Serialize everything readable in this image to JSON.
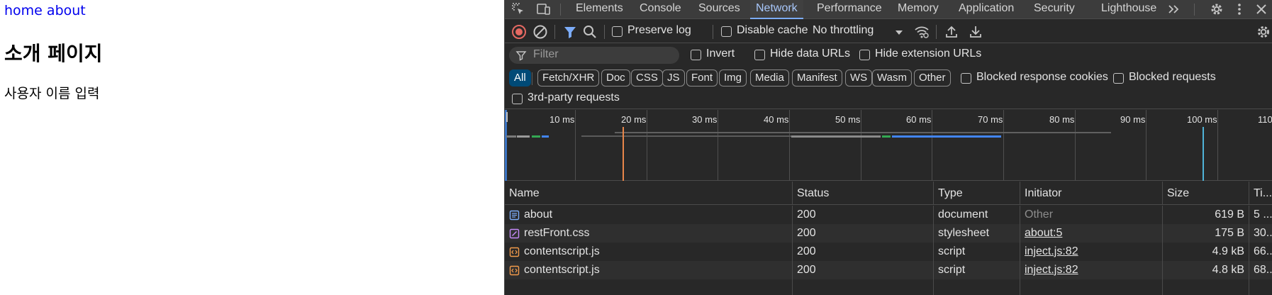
{
  "page": {
    "nav_links": [
      "home",
      "about"
    ],
    "heading": "소개 페이지",
    "body_text": "사용자 이름 입력"
  },
  "devtools": {
    "tabs": [
      "Elements",
      "Console",
      "Sources",
      "Network",
      "Performance",
      "Memory",
      "Application",
      "Security",
      "Lighthouse"
    ],
    "active_tab": "Network",
    "toolbar": {
      "preserve_log": "Preserve log",
      "disable_cache": "Disable cache",
      "throttling": "No throttling"
    },
    "filter": {
      "placeholder": "Filter",
      "invert": "Invert",
      "hide_data_urls": "Hide data URLs",
      "hide_extension_urls": "Hide extension URLs"
    },
    "type_filters": [
      "All",
      "Fetch/XHR",
      "Doc",
      "CSS",
      "JS",
      "Font",
      "Img",
      "Media",
      "Manifest",
      "WS",
      "Wasm",
      "Other"
    ],
    "blocked_response_cookies": "Blocked response cookies",
    "blocked_requests": "Blocked requests",
    "third_party_requests": "3rd-party requests",
    "timeline_ticks": [
      "10 ms",
      "20 ms",
      "30 ms",
      "40 ms",
      "50 ms",
      "60 ms",
      "70 ms",
      "80 ms",
      "90 ms",
      "100 ms",
      "110"
    ],
    "columns": [
      "Name",
      "Status",
      "Type",
      "Initiator",
      "Size",
      "Ti..."
    ],
    "rows": [
      {
        "name": "about",
        "status": "200",
        "type": "document",
        "initiator": "Other",
        "size": "619 B",
        "time": "5 ...",
        "icon": "document-icon"
      },
      {
        "name": "restFront.css",
        "status": "200",
        "type": "stylesheet",
        "initiator": "about:5",
        "size": "175 B",
        "time": "30...",
        "icon": "stylesheet-icon"
      },
      {
        "name": "contentscript.js",
        "status": "200",
        "type": "script",
        "initiator": "inject.js:82",
        "size": "4.9 kB",
        "time": "66...",
        "icon": "script-icon"
      },
      {
        "name": "contentscript.js",
        "status": "200",
        "type": "script",
        "initiator": "inject.js:82",
        "size": "4.8 kB",
        "time": "68...",
        "icon": "script-icon"
      }
    ],
    "colors": {
      "background": "#282828",
      "active_tab": "#a8c7fa",
      "record_red": "#e46962",
      "filter_blue": "#7cacf8",
      "doc_icon": "#7cacf8",
      "css_icon": "#c58af9",
      "script_icon": "#f29b4b"
    }
  }
}
